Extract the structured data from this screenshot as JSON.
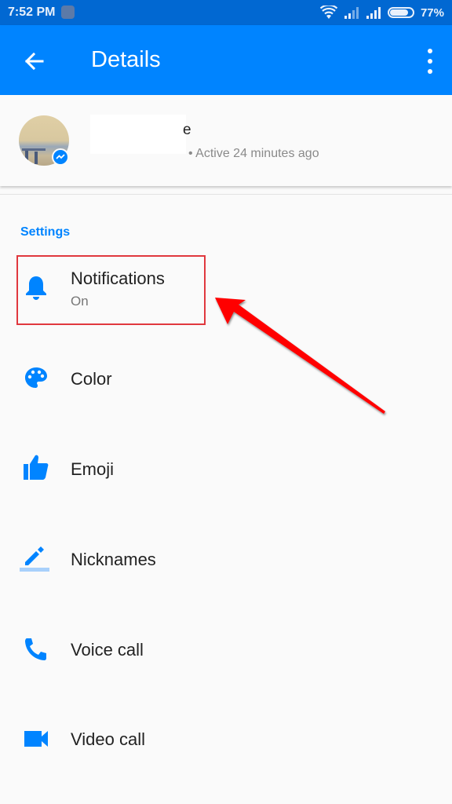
{
  "status_bar": {
    "time": "7:52 PM",
    "battery_percent": "77%",
    "battery_level": 0.77,
    "icons": [
      "app-notification-icon",
      "wifi-icon",
      "signal-icon",
      "signal-icon",
      "battery-icon"
    ]
  },
  "app_bar": {
    "back_icon": "arrow-left-icon",
    "title": "Details",
    "more_icon": "more-vert-icon"
  },
  "profile": {
    "name_visible_fragment": "e",
    "status": "• Active 24 minutes ago",
    "badge_icon": "messenger-icon"
  },
  "settings": {
    "section_title": "Settings",
    "items": [
      {
        "label": "Notifications",
        "sublabel": "On",
        "icon": "bell-icon"
      },
      {
        "label": "Color",
        "icon": "palette-icon"
      },
      {
        "label": "Emoji",
        "icon": "thumbs-up-icon"
      },
      {
        "label": "Nicknames",
        "icon": "pencil-icon"
      },
      {
        "label": "Voice call",
        "icon": "phone-icon"
      },
      {
        "label": "Video call",
        "icon": "video-icon"
      }
    ]
  },
  "annotation": {
    "highlight_color": "#e0383e",
    "arrow_color": "#ff0000",
    "target": "Notifications"
  },
  "colors": {
    "primary": "#0084ff",
    "status_bar": "#0168d2"
  }
}
